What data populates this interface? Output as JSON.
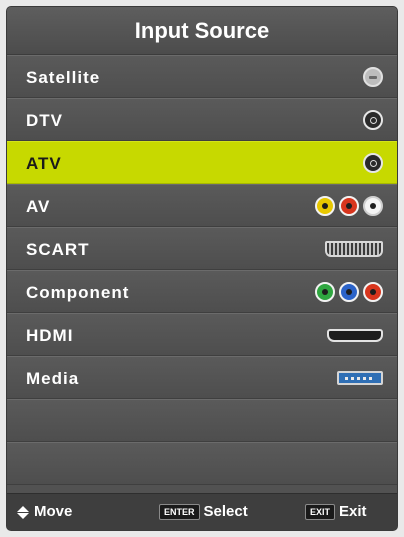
{
  "title": "Input Source",
  "sources": [
    {
      "label": "Satellite",
      "icon": "satellite-connector-icon"
    },
    {
      "label": "DTV",
      "icon": "coax-connector-icon"
    },
    {
      "label": "ATV",
      "icon": "coax-connector-icon",
      "selected": true
    },
    {
      "label": "AV",
      "icon": "rca-connectors-icon",
      "colors": [
        "#e8c800",
        "#d8351d",
        "#f4f4f4"
      ]
    },
    {
      "label": "SCART",
      "icon": "scart-connector-icon"
    },
    {
      "label": "Component",
      "icon": "component-connectors-icon",
      "colors": [
        "#2fa640",
        "#2b63c9",
        "#d8351d"
      ]
    },
    {
      "label": "HDMI",
      "icon": "hdmi-connector-icon"
    },
    {
      "label": "Media",
      "icon": "usb-connector-icon"
    }
  ],
  "selection_color": "#c7d900",
  "footer": {
    "move_label": "Move",
    "enter_key": "ENTER",
    "select_label": "Select",
    "exit_key": "EXIT",
    "exit_label": "Exit"
  }
}
